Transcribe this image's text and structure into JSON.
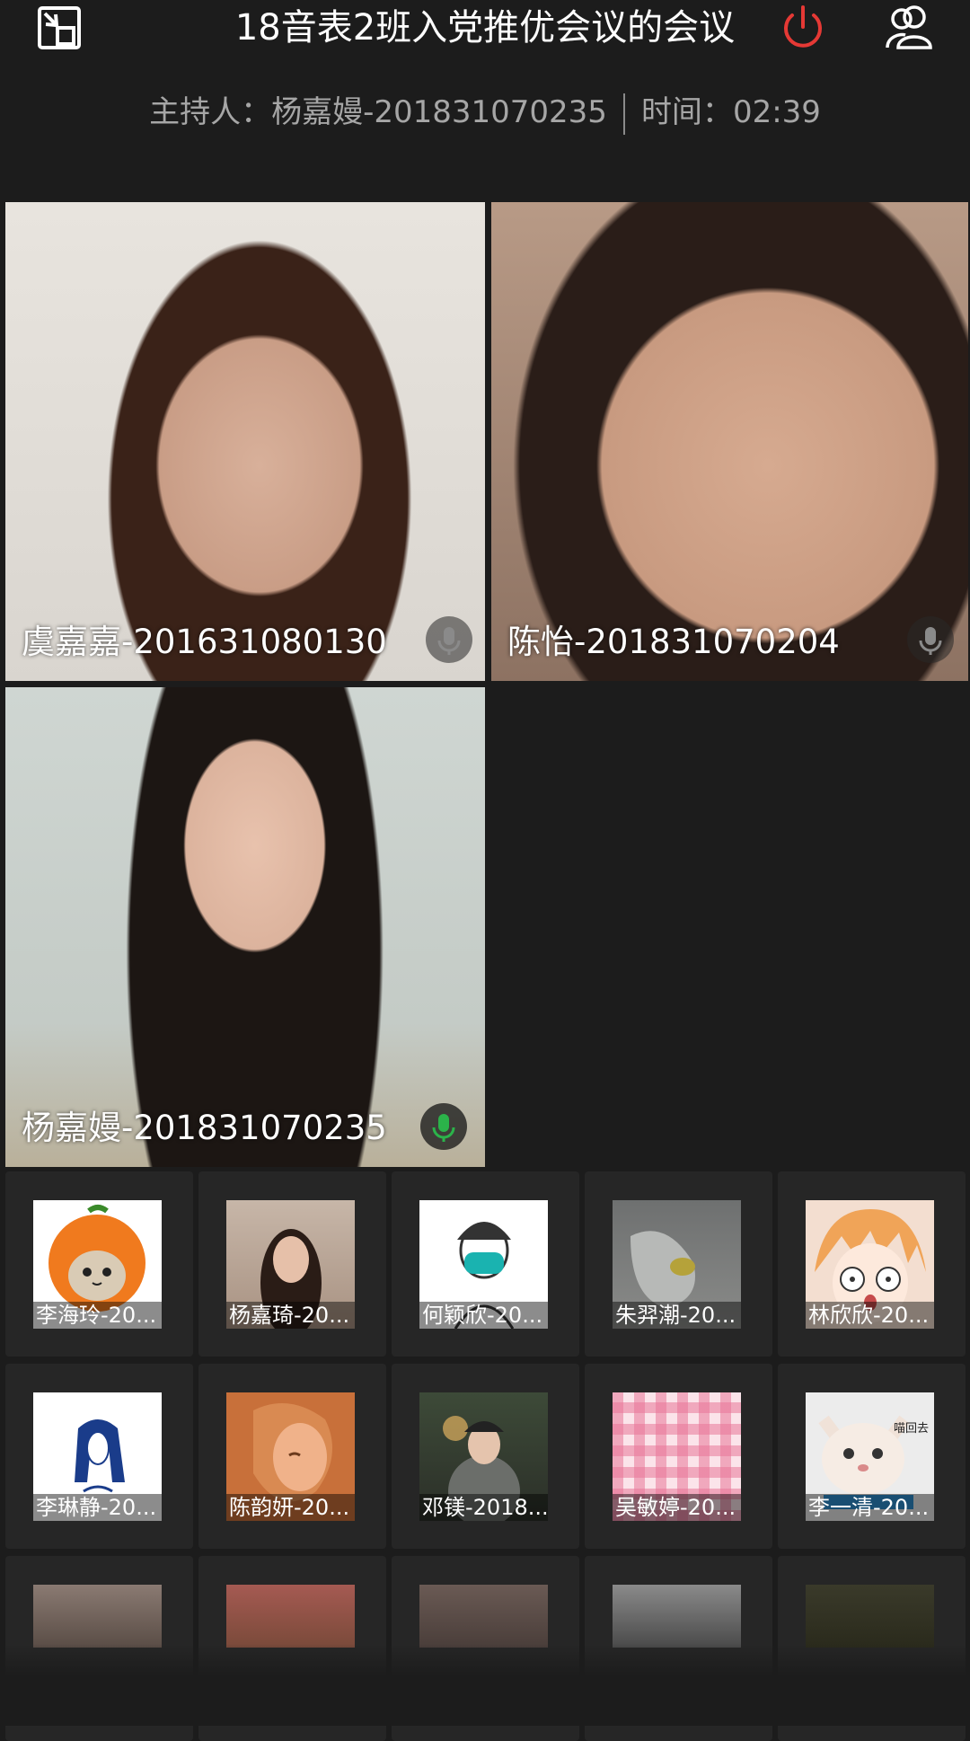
{
  "header": {
    "title": "18音表2班入党推优会议的会议",
    "host_label": "主持人：",
    "host_name": "杨嘉嫚-201831070235",
    "time_label": "时间：",
    "time_value": "02:39",
    "icons": {
      "exit": "exit-fullscreen-icon",
      "power": "power-icon",
      "members": "members-icon"
    },
    "colors": {
      "power": "#e53935",
      "mic_active": "#2bb34a"
    }
  },
  "videos": [
    {
      "name": "虞嘉嘉-201631080130",
      "mic": "mic-muted"
    },
    {
      "name": "陈怡-201831070204",
      "mic": "mic-muted"
    },
    {
      "name": "杨嘉嫚-201831070235",
      "mic": "mic-active"
    }
  ],
  "participants": [
    {
      "label": "李海玲-20..."
    },
    {
      "label": "杨嘉琦-20..."
    },
    {
      "label": "何颖欣-20..."
    },
    {
      "label": "朱羿潮-20..."
    },
    {
      "label": "林欣欣-20..."
    },
    {
      "label": "李琳静-20..."
    },
    {
      "label": "陈韵妍-20..."
    },
    {
      "label": "邓镁-2018..."
    },
    {
      "label": "吴敏婷-20..."
    },
    {
      "label": "李一清-20..."
    },
    {
      "label": ""
    },
    {
      "label": ""
    },
    {
      "label": ""
    },
    {
      "label": ""
    },
    {
      "label": ""
    }
  ],
  "thumb_text": {
    "p10": "喵回去"
  }
}
